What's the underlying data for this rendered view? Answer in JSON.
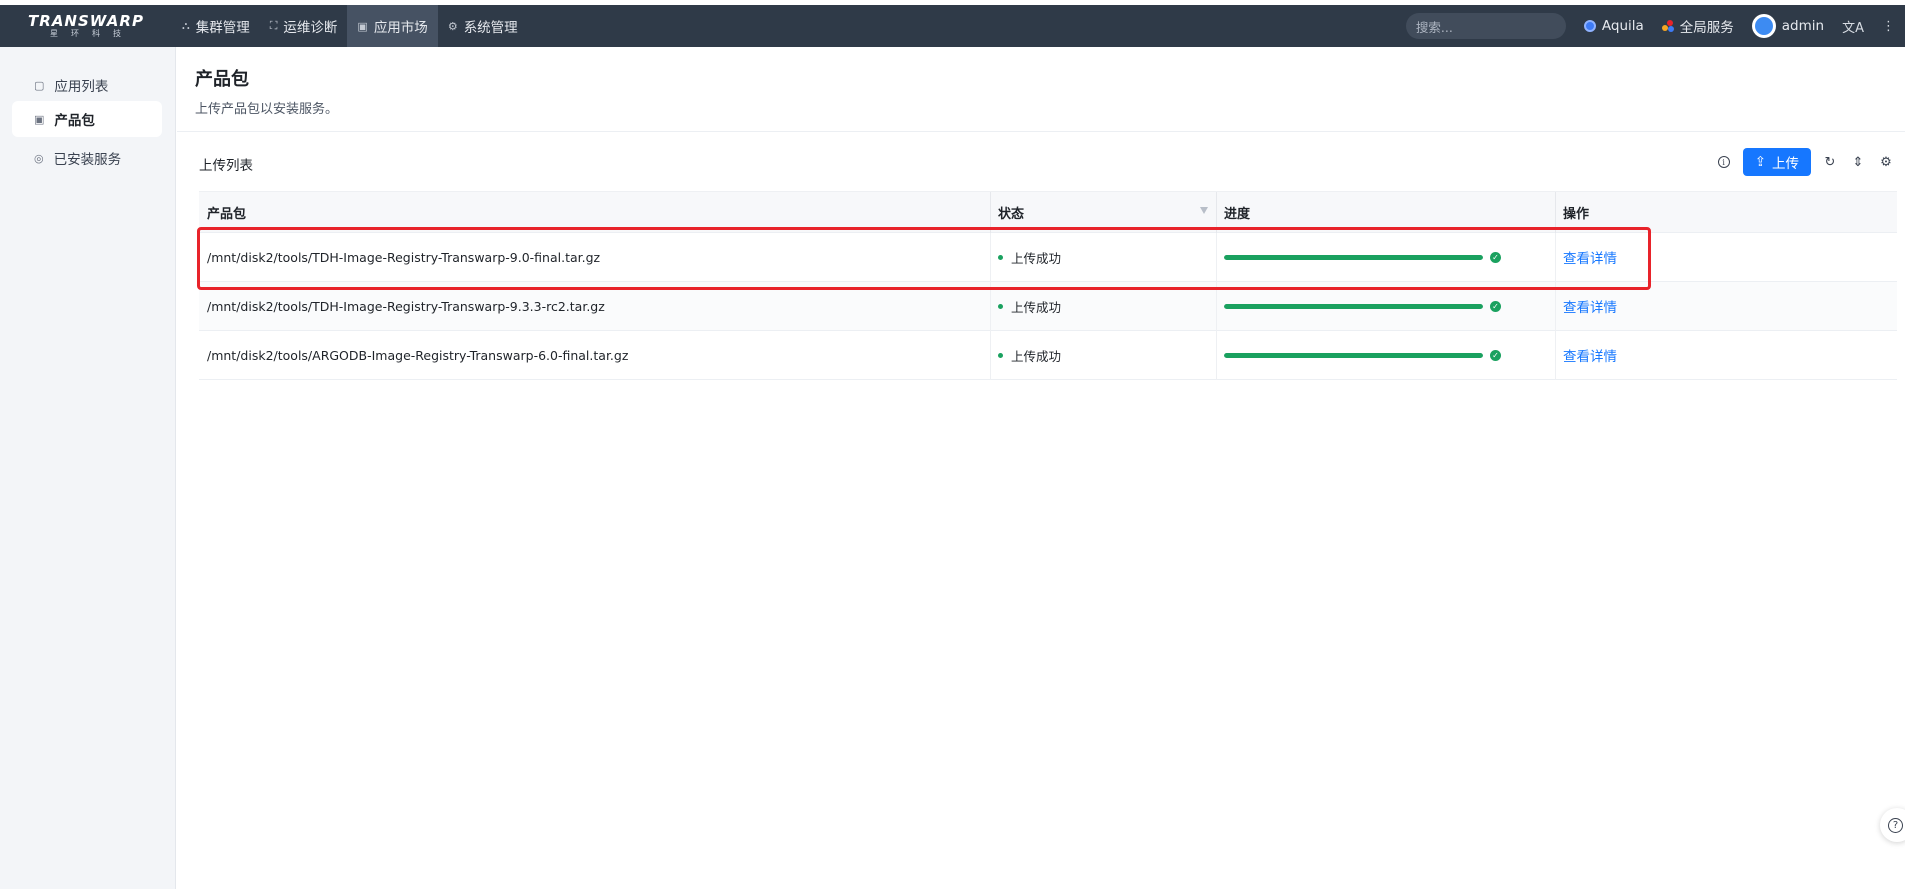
{
  "header": {
    "logo_text": "TRANSWARP",
    "logo_sub": "星环科技",
    "nav": [
      {
        "label": "集群管理",
        "icon": "cluster-icon"
      },
      {
        "label": "运维诊断",
        "icon": "diagnose-icon"
      },
      {
        "label": "应用市场",
        "icon": "market-icon",
        "active": true
      },
      {
        "label": "系统管理",
        "icon": "gear-icon"
      }
    ],
    "search_placeholder": "搜索...",
    "aquila_label": "Aquila",
    "global_service_label": "全局服务",
    "user_name": "admin"
  },
  "sidebar": {
    "items": [
      {
        "label": "应用列表",
        "icon": "app-list-icon"
      },
      {
        "label": "产品包",
        "icon": "package-icon",
        "active": true
      },
      {
        "label": "已安装服务",
        "icon": "installed-icon"
      }
    ]
  },
  "page": {
    "title": "产品包",
    "description": "上传产品包以安装服务。"
  },
  "upload_list": {
    "title": "上传列表",
    "upload_button": "上传",
    "columns": [
      "产品包",
      "状态",
      "进度",
      "操作"
    ],
    "rows": [
      {
        "package": "/mnt/disk2/tools/TDH-Image-Registry-Transwarp-9.0-final.tar.gz",
        "status": "上传成功",
        "progress": 1.0,
        "action": "查看详情"
      },
      {
        "package": "/mnt/disk2/tools/TDH-Image-Registry-Transwarp-9.3.3-rc2.tar.gz",
        "status": "上传成功",
        "progress": 1.0,
        "action": "查看详情"
      },
      {
        "package": "/mnt/disk2/tools/ARGODB-Image-Registry-Transwarp-6.0-final.tar.gz",
        "status": "上传成功",
        "progress": 1.0,
        "action": "查看详情"
      }
    ]
  },
  "colors": {
    "topbar": "#2f3a48",
    "accent": "#1677ff",
    "success": "#1aa15f",
    "highlight": "#e8232a"
  }
}
